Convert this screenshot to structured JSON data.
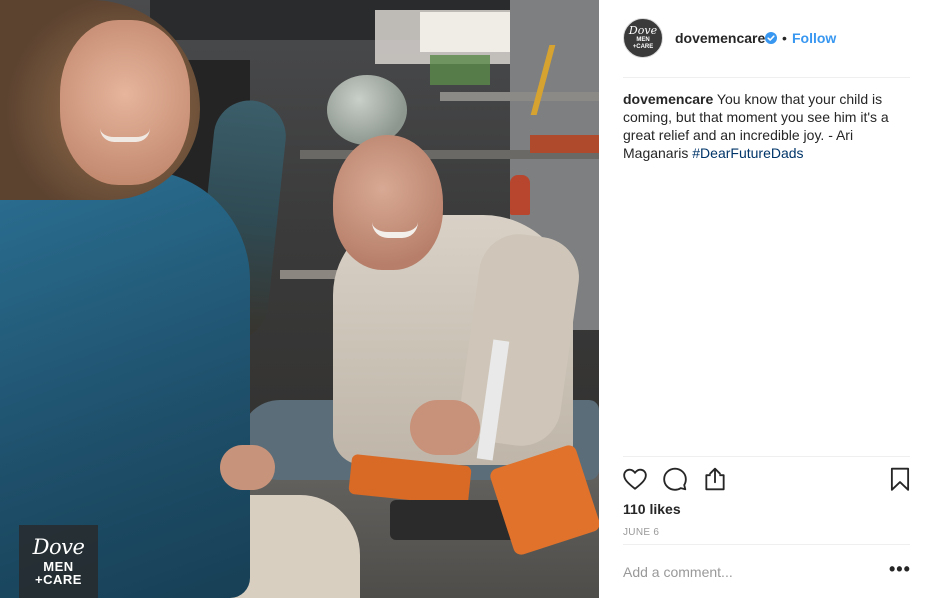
{
  "post": {
    "username": "dovemencare",
    "verified": true,
    "dot": "•",
    "follow_label": "Follow",
    "caption_user": "dovemencare",
    "caption_text": " You know that your child is coming, but that moment you see him it's a great relief and an incredible joy. - Ari Maganaris ",
    "caption_hashtag": "#DearFutureDads",
    "likes": "110 likes",
    "date": "JUNE 6",
    "comment_placeholder": "Add a comment...",
    "more_label": "•••"
  },
  "logo": {
    "line1": "Dove",
    "line2": "MEN",
    "line3": "+CARE"
  },
  "icons": {
    "like": "heart-icon",
    "comment": "comment-icon",
    "share": "share-icon",
    "save": "bookmark-icon",
    "verified": "verified-badge-icon"
  },
  "colors": {
    "link": "#3897f0",
    "hashtag": "#003569",
    "muted": "#999999",
    "text": "#262626"
  }
}
